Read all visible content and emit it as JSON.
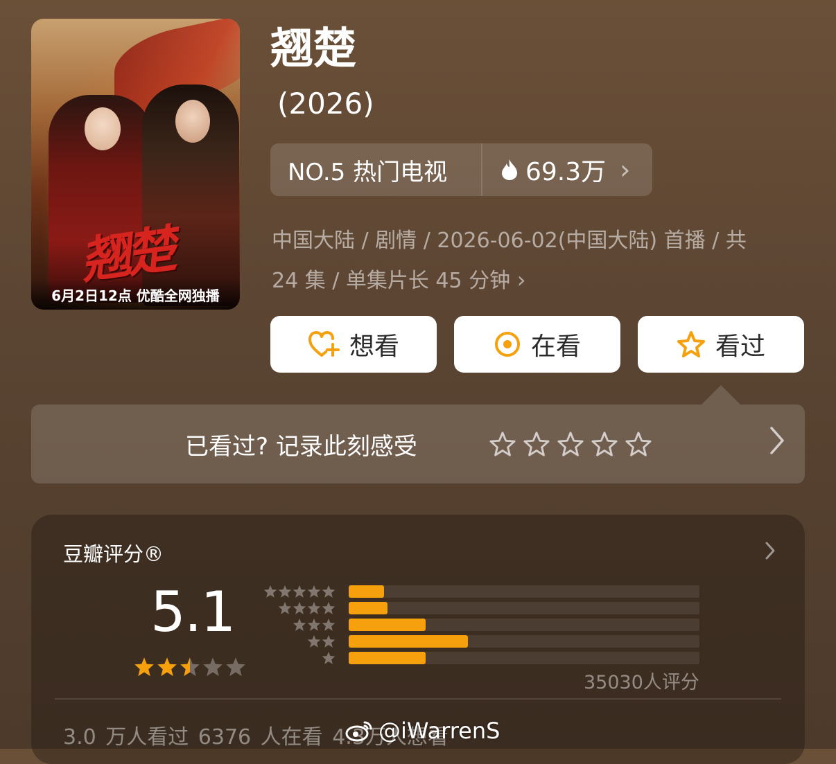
{
  "poster": {
    "calligraphy": "翘楚",
    "caption": "6月2日12点 优酷全网独播"
  },
  "title": "翘楚",
  "year": "(2026)",
  "rank": {
    "label": "NO.5 热门电视",
    "heat": "69.3万",
    "icon": "flame-icon"
  },
  "meta": {
    "line1": "中国大陆 / 剧情 / 2026-06-02(中国大陆) 首播 / 共",
    "line2": "24 集 / 单集片长 45 分钟"
  },
  "actions": {
    "want": "想看",
    "doing": "在看",
    "done": "看过"
  },
  "record": {
    "text": "已看过? 记录此刻感受"
  },
  "rating": {
    "title": "豆瓣评分®",
    "score": "5.1",
    "stars_value": 2.5,
    "stars_max": 5,
    "distribution_fraction": [
      0.1,
      0.11,
      0.22,
      0.34,
      0.22
    ],
    "count_text": "35030人评分",
    "stats": "3.0 万人看过   6376 人在看   4.3万人想看"
  },
  "watermark": "@iWarrenS",
  "colors": {
    "accent": "#f5a00c",
    "button_bg": "#ffffff",
    "text_muted": "rgba(255,255,255,0.55)"
  }
}
